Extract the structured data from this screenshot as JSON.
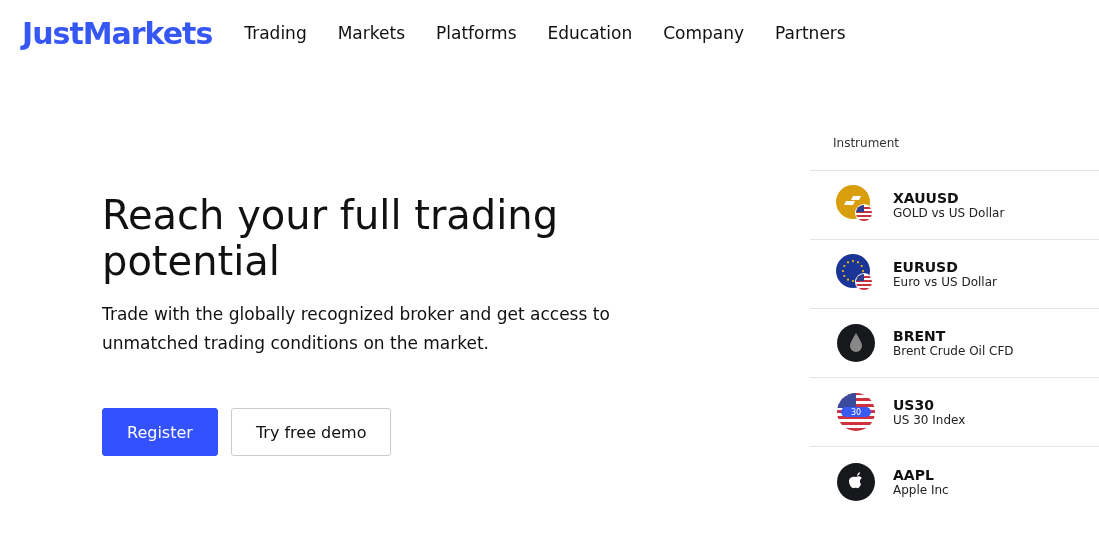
{
  "header": {
    "logo": "JustMarkets",
    "nav": [
      "Trading",
      "Markets",
      "Platforms",
      "Education",
      "Company",
      "Partners"
    ]
  },
  "hero": {
    "title": "Reach your full trading potential",
    "text": "Trade with the globally recognized broker and get access to unmatched trading conditions on the market.",
    "buttons": [
      {
        "label": "Register",
        "kind": "primary"
      },
      {
        "label": "Try free demo",
        "kind": "secondary"
      }
    ]
  },
  "instruments": {
    "heading": "Instrument",
    "rows": [
      {
        "symbol": "XAUUSD",
        "name": "GOLD vs US Dollar",
        "kind": "gold"
      },
      {
        "symbol": "EURUSD",
        "name": "Euro vs US Dollar",
        "kind": "euro"
      },
      {
        "symbol": "BRENT",
        "name": "Brent Crude Oil CFD",
        "kind": "oil"
      },
      {
        "symbol": "US30",
        "name": "US 30 Index",
        "kind": "index",
        "badge": "30"
      },
      {
        "symbol": "AAPL",
        "name": "Apple Inc",
        "kind": "apple"
      }
    ]
  }
}
